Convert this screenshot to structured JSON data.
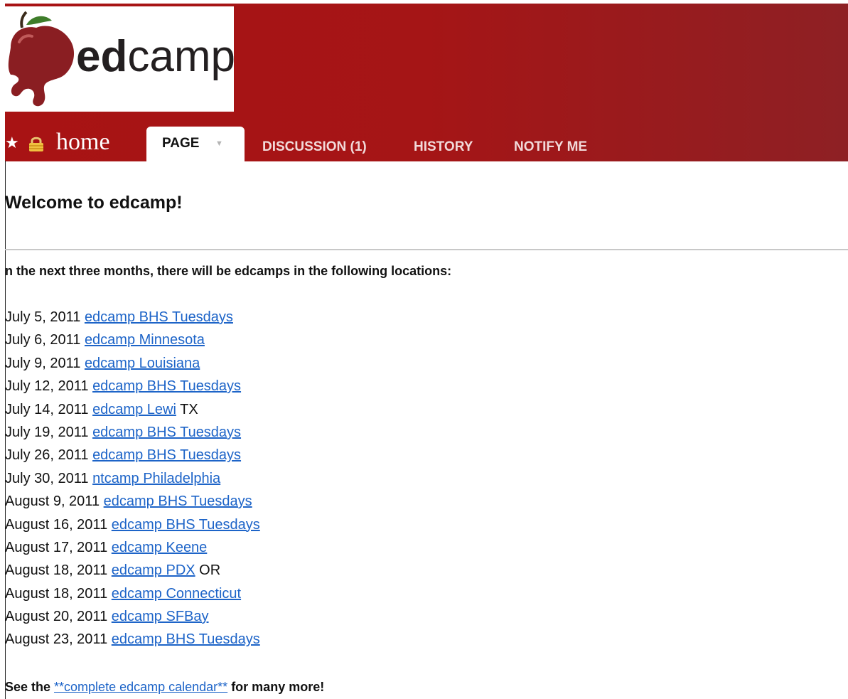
{
  "header": {
    "logo": {
      "text_bold": "ed",
      "text_light": "camp"
    },
    "page_name": "home",
    "tabs": [
      {
        "label": "PAGE",
        "active": true
      },
      {
        "label": "DISCUSSION (1)",
        "active": false
      },
      {
        "label": "HISTORY",
        "active": false
      },
      {
        "label": "NOTIFY ME",
        "active": false
      }
    ],
    "icons": [
      "star-icon",
      "lock-icon",
      "chevron-down-icon"
    ]
  },
  "content": {
    "heading": "Welcome to edcamp!",
    "intro": "n the next three months, there will be edcamps in the following locations:",
    "events": [
      {
        "date": "July 5, 2011",
        "link": "edcamp BHS Tuesdays",
        "suffix": ""
      },
      {
        "date": "July 6, 2011",
        "link": "edcamp Minnesota",
        "suffix": ""
      },
      {
        "date": "July 9, 2011",
        "link": "edcamp Louisiana",
        "suffix": ""
      },
      {
        "date": "July 12, 2011",
        "link": "edcamp BHS Tuesdays",
        "suffix": ""
      },
      {
        "date": "July 14, 2011",
        "link": "edcamp Lewi",
        "suffix": "TX"
      },
      {
        "date": "July 19, 2011",
        "link": "edcamp BHS Tuesdays",
        "suffix": ""
      },
      {
        "date": "July 26, 2011",
        "link": "edcamp BHS Tuesdays",
        "suffix": ""
      },
      {
        "date": "July 30, 2011",
        "link": "ntcamp Philadelphia",
        "suffix": ""
      },
      {
        "date": "August 9, 2011",
        "link": "edcamp BHS Tuesdays",
        "suffix": ""
      },
      {
        "date": "August 16, 2011",
        "link": "edcamp BHS Tuesdays",
        "suffix": ""
      },
      {
        "date": "August 17, 2011",
        "link": "edcamp Keene",
        "suffix": ""
      },
      {
        "date": "August 18, 2011",
        "link": "edcamp PDX",
        "suffix": "OR"
      },
      {
        "date": "August 18, 2011",
        "link": "edcamp Connecticut",
        "suffix": ""
      },
      {
        "date": "August 20, 2011",
        "link": "edcamp SFBay",
        "suffix": ""
      },
      {
        "date": "August 23, 2011",
        "link": "edcamp BHS Tuesdays",
        "suffix": ""
      }
    ],
    "see_more": {
      "before": "See the ",
      "link": "**complete edcamp calendar**",
      "after": " for many more!"
    }
  },
  "colors": {
    "header_red": "#a81314",
    "link_blue": "#1d64c8",
    "logo_apple": "#8a1e22"
  }
}
